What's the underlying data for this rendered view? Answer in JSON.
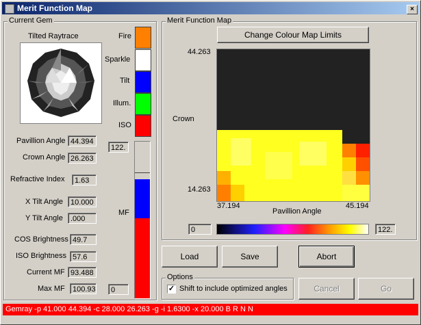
{
  "window": {
    "title": "Merit Function Map",
    "close_glyph": "×"
  },
  "current_gem": {
    "group_label": "Current Gem",
    "preview_label": "Tilted Raytrace",
    "legend": [
      {
        "label": "Fire",
        "color": "#ff8000"
      },
      {
        "label": "Sparkle",
        "color": "#ffffff"
      },
      {
        "label": "Tilt",
        "color": "#0000ff"
      },
      {
        "label": "Illum.",
        "color": "#00ff00"
      },
      {
        "label": "ISO",
        "color": "#ff0000"
      }
    ],
    "fields": {
      "pavillion_angle": {
        "label": "Pavillion Angle",
        "value": "44.394"
      },
      "crown_angle": {
        "label": "Crown Angle",
        "value": "26.263"
      },
      "refractive_index": {
        "label": "Refractive Index",
        "value": "1.63"
      },
      "x_tilt_angle": {
        "label": "X Tilt Angle",
        "value": "10.000"
      },
      "y_tilt_angle": {
        "label": "Y Tilt Angle",
        "value": ".000"
      },
      "cos_brightness": {
        "label": "COS Brightness",
        "value": "49.7"
      },
      "iso_brightness": {
        "label": "ISO Brightness",
        "value": "57.6"
      },
      "current_mf": {
        "label": "Current MF",
        "value": "93.488"
      },
      "max_mf": {
        "label": "Max MF",
        "value": "100.93"
      }
    },
    "mf_bar": {
      "label": "MF",
      "max_value": "122.",
      "min_value": "0"
    }
  },
  "merit_map": {
    "group_label": "Merit Function Map",
    "change_button": "Change Colour Map Limits",
    "y_label": "Crown",
    "y_max": "44.263",
    "y_min": "14.263",
    "x_label": "Pavillion Angle",
    "x_min": "37.194",
    "x_max": "45.194",
    "scale_min": "0",
    "scale_max": "122."
  },
  "buttons": {
    "load": "Load",
    "save": "Save",
    "abort": "Abort",
    "cancel": "Cancel",
    "go": "Go"
  },
  "options": {
    "group_label": "Options",
    "checkbox_label": "Shift to include optimized angles",
    "checked": true
  },
  "status_bar": "Gemray -p 41.000 44.394 -c 28.000 26.263 -g -i 1.6300 -x 20.000 B R N N"
}
